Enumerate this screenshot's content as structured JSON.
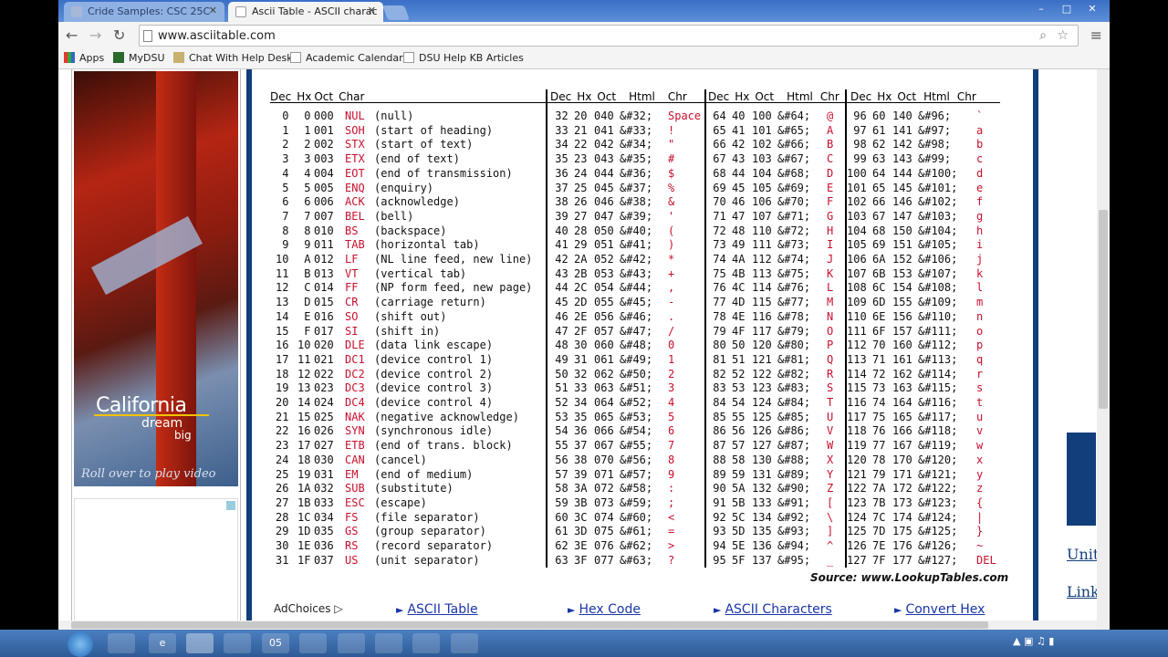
{
  "browser": {
    "tabs": [
      {
        "label": "Cride Samples: CSC 25C"
      },
      {
        "label": "Ascii Table - ASCII charac"
      }
    ],
    "url": "www.asciitable.com",
    "window_controls": [
      "–",
      "□",
      "✕"
    ]
  },
  "bookmarks": [
    "Apps",
    "MyDSU",
    "Chat With Help Desk",
    "Academic Calendar",
    "DSU Help KB Articles"
  ],
  "ad": {
    "line1": "California",
    "line2": "dream",
    "line3": "big",
    "roll": "Roll over to play video"
  },
  "table": {
    "header_group": [
      "Dec",
      "Hx",
      "Oct",
      "Html",
      "Chr"
    ],
    "header_first": [
      "Dec",
      "Hx",
      "Oct",
      "Char"
    ],
    "control": [
      [
        "0",
        "0",
        "000",
        "NUL",
        "(null)"
      ],
      [
        "1",
        "1",
        "001",
        "SOH",
        "(start of heading)"
      ],
      [
        "2",
        "2",
        "002",
        "STX",
        "(start of text)"
      ],
      [
        "3",
        "3",
        "003",
        "ETX",
        "(end of text)"
      ],
      [
        "4",
        "4",
        "004",
        "EOT",
        "(end of transmission)"
      ],
      [
        "5",
        "5",
        "005",
        "ENQ",
        "(enquiry)"
      ],
      [
        "6",
        "6",
        "006",
        "ACK",
        "(acknowledge)"
      ],
      [
        "7",
        "7",
        "007",
        "BEL",
        "(bell)"
      ],
      [
        "8",
        "8",
        "010",
        "BS",
        "(backspace)"
      ],
      [
        "9",
        "9",
        "011",
        "TAB",
        "(horizontal tab)"
      ],
      [
        "10",
        "A",
        "012",
        "LF",
        "(NL line feed, new line)"
      ],
      [
        "11",
        "B",
        "013",
        "VT",
        "(vertical tab)"
      ],
      [
        "12",
        "C",
        "014",
        "FF",
        "(NP form feed, new page)"
      ],
      [
        "13",
        "D",
        "015",
        "CR",
        "(carriage return)"
      ],
      [
        "14",
        "E",
        "016",
        "SO",
        "(shift out)"
      ],
      [
        "15",
        "F",
        "017",
        "SI",
        "(shift in)"
      ],
      [
        "16",
        "10",
        "020",
        "DLE",
        "(data link escape)"
      ],
      [
        "17",
        "11",
        "021",
        "DC1",
        "(device control 1)"
      ],
      [
        "18",
        "12",
        "022",
        "DC2",
        "(device control 2)"
      ],
      [
        "19",
        "13",
        "023",
        "DC3",
        "(device control 3)"
      ],
      [
        "20",
        "14",
        "024",
        "DC4",
        "(device control 4)"
      ],
      [
        "21",
        "15",
        "025",
        "NAK",
        "(negative acknowledge)"
      ],
      [
        "22",
        "16",
        "026",
        "SYN",
        "(synchronous idle)"
      ],
      [
        "23",
        "17",
        "027",
        "ETB",
        "(end of trans. block)"
      ],
      [
        "24",
        "18",
        "030",
        "CAN",
        "(cancel)"
      ],
      [
        "25",
        "19",
        "031",
        "EM",
        "(end of medium)"
      ],
      [
        "26",
        "1A",
        "032",
        "SUB",
        "(substitute)"
      ],
      [
        "27",
        "1B",
        "033",
        "ESC",
        "(escape)"
      ],
      [
        "28",
        "1C",
        "034",
        "FS",
        "(file separator)"
      ],
      [
        "29",
        "1D",
        "035",
        "GS",
        "(group separator)"
      ],
      [
        "30",
        "1E",
        "036",
        "RS",
        "(record separator)"
      ],
      [
        "31",
        "1F",
        "037",
        "US",
        "(unit separator)"
      ]
    ],
    "group2": [
      [
        "32",
        "20",
        "040",
        "&#32;",
        "Space"
      ],
      [
        "33",
        "21",
        "041",
        "&#33;",
        "!"
      ],
      [
        "34",
        "22",
        "042",
        "&#34;",
        "\""
      ],
      [
        "35",
        "23",
        "043",
        "&#35;",
        "#"
      ],
      [
        "36",
        "24",
        "044",
        "&#36;",
        "$"
      ],
      [
        "37",
        "25",
        "045",
        "&#37;",
        "%"
      ],
      [
        "38",
        "26",
        "046",
        "&#38;",
        "&"
      ],
      [
        "39",
        "27",
        "047",
        "&#39;",
        "'"
      ],
      [
        "40",
        "28",
        "050",
        "&#40;",
        "("
      ],
      [
        "41",
        "29",
        "051",
        "&#41;",
        ")"
      ],
      [
        "42",
        "2A",
        "052",
        "&#42;",
        "*"
      ],
      [
        "43",
        "2B",
        "053",
        "&#43;",
        "+"
      ],
      [
        "44",
        "2C",
        "054",
        "&#44;",
        ","
      ],
      [
        "45",
        "2D",
        "055",
        "&#45;",
        "-"
      ],
      [
        "46",
        "2E",
        "056",
        "&#46;",
        "."
      ],
      [
        "47",
        "2F",
        "057",
        "&#47;",
        "/"
      ],
      [
        "48",
        "30",
        "060",
        "&#48;",
        "0"
      ],
      [
        "49",
        "31",
        "061",
        "&#49;",
        "1"
      ],
      [
        "50",
        "32",
        "062",
        "&#50;",
        "2"
      ],
      [
        "51",
        "33",
        "063",
        "&#51;",
        "3"
      ],
      [
        "52",
        "34",
        "064",
        "&#52;",
        "4"
      ],
      [
        "53",
        "35",
        "065",
        "&#53;",
        "5"
      ],
      [
        "54",
        "36",
        "066",
        "&#54;",
        "6"
      ],
      [
        "55",
        "37",
        "067",
        "&#55;",
        "7"
      ],
      [
        "56",
        "38",
        "070",
        "&#56;",
        "8"
      ],
      [
        "57",
        "39",
        "071",
        "&#57;",
        "9"
      ],
      [
        "58",
        "3A",
        "072",
        "&#58;",
        ":"
      ],
      [
        "59",
        "3B",
        "073",
        "&#59;",
        ";"
      ],
      [
        "60",
        "3C",
        "074",
        "&#60;",
        "<"
      ],
      [
        "61",
        "3D",
        "075",
        "&#61;",
        "="
      ],
      [
        "62",
        "3E",
        "076",
        "&#62;",
        ">"
      ],
      [
        "63",
        "3F",
        "077",
        "&#63;",
        "?"
      ]
    ],
    "group3": [
      [
        "64",
        "40",
        "100",
        "&#64;",
        "@"
      ],
      [
        "65",
        "41",
        "101",
        "&#65;",
        "A"
      ],
      [
        "66",
        "42",
        "102",
        "&#66;",
        "B"
      ],
      [
        "67",
        "43",
        "103",
        "&#67;",
        "C"
      ],
      [
        "68",
        "44",
        "104",
        "&#68;",
        "D"
      ],
      [
        "69",
        "45",
        "105",
        "&#69;",
        "E"
      ],
      [
        "70",
        "46",
        "106",
        "&#70;",
        "F"
      ],
      [
        "71",
        "47",
        "107",
        "&#71;",
        "G"
      ],
      [
        "72",
        "48",
        "110",
        "&#72;",
        "H"
      ],
      [
        "73",
        "49",
        "111",
        "&#73;",
        "I"
      ],
      [
        "74",
        "4A",
        "112",
        "&#74;",
        "J"
      ],
      [
        "75",
        "4B",
        "113",
        "&#75;",
        "K"
      ],
      [
        "76",
        "4C",
        "114",
        "&#76;",
        "L"
      ],
      [
        "77",
        "4D",
        "115",
        "&#77;",
        "M"
      ],
      [
        "78",
        "4E",
        "116",
        "&#78;",
        "N"
      ],
      [
        "79",
        "4F",
        "117",
        "&#79;",
        "O"
      ],
      [
        "80",
        "50",
        "120",
        "&#80;",
        "P"
      ],
      [
        "81",
        "51",
        "121",
        "&#81;",
        "Q"
      ],
      [
        "82",
        "52",
        "122",
        "&#82;",
        "R"
      ],
      [
        "83",
        "53",
        "123",
        "&#83;",
        "S"
      ],
      [
        "84",
        "54",
        "124",
        "&#84;",
        "T"
      ],
      [
        "85",
        "55",
        "125",
        "&#85;",
        "U"
      ],
      [
        "86",
        "56",
        "126",
        "&#86;",
        "V"
      ],
      [
        "87",
        "57",
        "127",
        "&#87;",
        "W"
      ],
      [
        "88",
        "58",
        "130",
        "&#88;",
        "X"
      ],
      [
        "89",
        "59",
        "131",
        "&#89;",
        "Y"
      ],
      [
        "90",
        "5A",
        "132",
        "&#90;",
        "Z"
      ],
      [
        "91",
        "5B",
        "133",
        "&#91;",
        "["
      ],
      [
        "92",
        "5C",
        "134",
        "&#92;",
        "\\"
      ],
      [
        "93",
        "5D",
        "135",
        "&#93;",
        "]"
      ],
      [
        "94",
        "5E",
        "136",
        "&#94;",
        "^"
      ],
      [
        "95",
        "5F",
        "137",
        "&#95;",
        "_"
      ]
    ],
    "group4": [
      [
        "96",
        "60",
        "140",
        "&#96;",
        "`"
      ],
      [
        "97",
        "61",
        "141",
        "&#97;",
        "a"
      ],
      [
        "98",
        "62",
        "142",
        "&#98;",
        "b"
      ],
      [
        "99",
        "63",
        "143",
        "&#99;",
        "c"
      ],
      [
        "100",
        "64",
        "144",
        "&#100;",
        "d"
      ],
      [
        "101",
        "65",
        "145",
        "&#101;",
        "e"
      ],
      [
        "102",
        "66",
        "146",
        "&#102;",
        "f"
      ],
      [
        "103",
        "67",
        "147",
        "&#103;",
        "g"
      ],
      [
        "104",
        "68",
        "150",
        "&#104;",
        "h"
      ],
      [
        "105",
        "69",
        "151",
        "&#105;",
        "i"
      ],
      [
        "106",
        "6A",
        "152",
        "&#106;",
        "j"
      ],
      [
        "107",
        "6B",
        "153",
        "&#107;",
        "k"
      ],
      [
        "108",
        "6C",
        "154",
        "&#108;",
        "l"
      ],
      [
        "109",
        "6D",
        "155",
        "&#109;",
        "m"
      ],
      [
        "110",
        "6E",
        "156",
        "&#110;",
        "n"
      ],
      [
        "111",
        "6F",
        "157",
        "&#111;",
        "o"
      ],
      [
        "112",
        "70",
        "160",
        "&#112;",
        "p"
      ],
      [
        "113",
        "71",
        "161",
        "&#113;",
        "q"
      ],
      [
        "114",
        "72",
        "162",
        "&#114;",
        "r"
      ],
      [
        "115",
        "73",
        "163",
        "&#115;",
        "s"
      ],
      [
        "116",
        "74",
        "164",
        "&#116;",
        "t"
      ],
      [
        "117",
        "75",
        "165",
        "&#117;",
        "u"
      ],
      [
        "118",
        "76",
        "166",
        "&#118;",
        "v"
      ],
      [
        "119",
        "77",
        "167",
        "&#119;",
        "w"
      ],
      [
        "120",
        "78",
        "170",
        "&#120;",
        "x"
      ],
      [
        "121",
        "79",
        "171",
        "&#121;",
        "y"
      ],
      [
        "122",
        "7A",
        "172",
        "&#122;",
        "z"
      ],
      [
        "123",
        "7B",
        "173",
        "&#123;",
        "{"
      ],
      [
        "124",
        "7C",
        "174",
        "&#124;",
        "|"
      ],
      [
        "125",
        "7D",
        "175",
        "&#125;",
        "}"
      ],
      [
        "126",
        "7E",
        "176",
        "&#126;",
        "~"
      ],
      [
        "127",
        "7F",
        "177",
        "&#127;",
        "DEL"
      ]
    ],
    "source": "Source:  www.LookupTables.com"
  },
  "bottom_nav": {
    "adchoices": "AdChoices",
    "links": [
      "ASCII Table",
      "Hex Code",
      "ASCII Characters",
      "Convert Hex"
    ]
  },
  "side_links": [
    "Unit",
    "Link"
  ],
  "taskbar": [
    "",
    "e",
    "",
    "",
    "05",
    "",
    "",
    "",
    ""
  ]
}
